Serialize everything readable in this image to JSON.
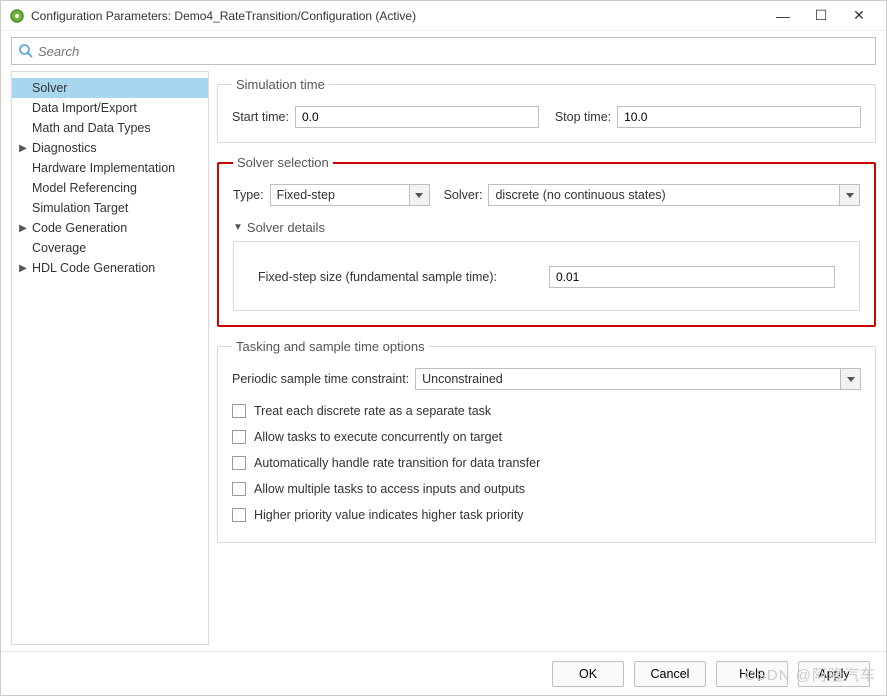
{
  "window": {
    "title": "Configuration Parameters: Demo4_RateTransition/Configuration (Active)"
  },
  "search": {
    "placeholder": "Search"
  },
  "nav": {
    "items": [
      {
        "label": "Solver",
        "expandable": false,
        "selected": true
      },
      {
        "label": "Data Import/Export",
        "expandable": false
      },
      {
        "label": "Math and Data Types",
        "expandable": false
      },
      {
        "label": "Diagnostics",
        "expandable": true
      },
      {
        "label": "Hardware Implementation",
        "expandable": false
      },
      {
        "label": "Model Referencing",
        "expandable": false
      },
      {
        "label": "Simulation Target",
        "expandable": false
      },
      {
        "label": "Code Generation",
        "expandable": true
      },
      {
        "label": "Coverage",
        "expandable": false
      },
      {
        "label": "HDL Code Generation",
        "expandable": true
      }
    ]
  },
  "sim_time": {
    "title": "Simulation time",
    "start_label": "Start time:",
    "start_value": "0.0",
    "stop_label": "Stop time:",
    "stop_value": "10.0"
  },
  "solver_sel": {
    "title": "Solver selection",
    "type_label": "Type:",
    "type_value": "Fixed-step",
    "solver_label": "Solver:",
    "solver_value": "discrete (no continuous states)",
    "details_title": "Solver details",
    "fixed_step_label": "Fixed-step size (fundamental sample time):",
    "fixed_step_value": "0.01"
  },
  "tasking": {
    "title": "Tasking and sample time options",
    "constraint_label": "Periodic sample time constraint:",
    "constraint_value": "Unconstrained",
    "checks": [
      "Treat each discrete rate as a separate task",
      "Allow tasks to execute concurrently on target",
      "Automatically handle rate transition for data transfer",
      "Allow multiple tasks to access inputs and outputs",
      "Higher priority value indicates higher task priority"
    ]
  },
  "buttons": {
    "ok": "OK",
    "cancel": "Cancel",
    "help": "Help",
    "apply": "Apply"
  },
  "watermark": "CSDN @阿隆汽车"
}
